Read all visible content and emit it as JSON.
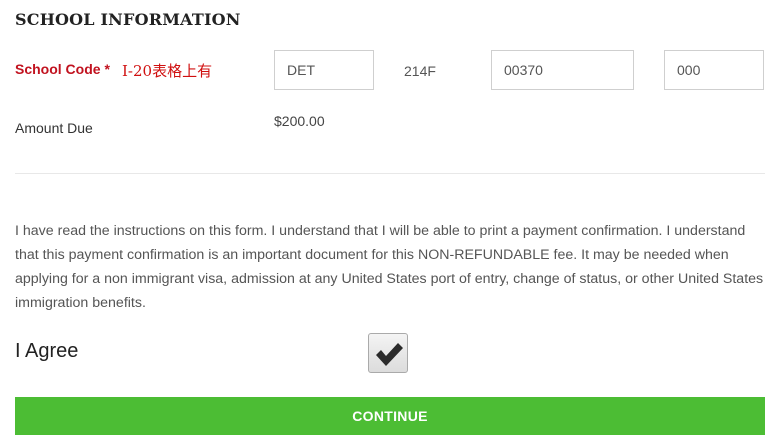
{
  "section": {
    "title": "SCHOOL INFORMATION"
  },
  "school_code": {
    "label": "School Code *",
    "annotation": "I-20表格上有",
    "part1": "DET",
    "part2": "214F",
    "part3": "00370",
    "part4": "000"
  },
  "amount_due": {
    "label": "Amount Due",
    "value": "$200.00"
  },
  "agreement": {
    "text": "I have read the instructions on this form. I understand that I will be able to print a payment confirmation. I understand that this payment confirmation is an important document for this NON-REFUNDABLE fee. It may be needed when applying for a non immigrant visa, admission at any United States port of entry, change of status, or other United States immigration benefits."
  },
  "agree": {
    "label": "I Agree",
    "checked": true
  },
  "continue_button": {
    "label": "CONTINUE"
  },
  "colors": {
    "required_label": "#c1121f",
    "annotation": "#d01010",
    "continue_bg": "#4cbd34"
  },
  "icons": {
    "checkbox_mark": "checkmark-icon"
  }
}
